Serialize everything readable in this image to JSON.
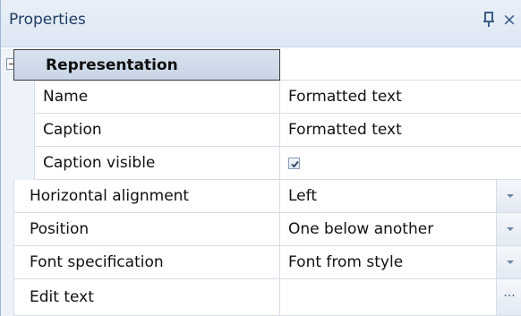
{
  "panel": {
    "title": "Properties",
    "pin_icon": "pin-icon",
    "close_icon": "close-icon",
    "close_glyph": "×"
  },
  "group": {
    "label": "Representation",
    "expander_icon": "collapse-minus-icon"
  },
  "rows": [
    {
      "name": "Name",
      "value": "Formatted text"
    },
    {
      "name": "Caption",
      "value": "Formatted text"
    },
    {
      "name": "Caption visible",
      "value": "",
      "checked": true
    },
    {
      "name": "Horizontal alignment",
      "value": "Left",
      "editor": "dropdown"
    },
    {
      "name": "Position",
      "value": "One below another",
      "editor": "dropdown"
    },
    {
      "name": "Font specification",
      "value": "Font from style",
      "editor": "dropdown"
    },
    {
      "name": "Edit text",
      "value": "",
      "editor": "ellipsis",
      "ellipsis_label": "..."
    }
  ],
  "colors": {
    "header_text": "#1f3b64",
    "grid_line": "#d6dde7",
    "group_header_bg": "#c7d5e6"
  }
}
